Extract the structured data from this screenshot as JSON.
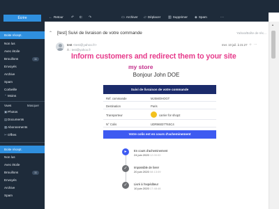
{
  "sidebar": {
    "compose_label": "Écrire",
    "folders_top": [
      {
        "label": "Boite récept.",
        "count": "",
        "active": true
      },
      {
        "label": "Non lus",
        "count": ""
      },
      {
        "label": "Avec étoile",
        "count": ""
      },
      {
        "label": "Brouillons",
        "count": "11"
      },
      {
        "label": "Envoyés",
        "count": ""
      },
      {
        "label": "Archive",
        "count": ""
      },
      {
        "label": "Spam",
        "count": ""
      },
      {
        "label": "Corbeille",
        "count": ""
      },
      {
        "label": "Moins",
        "count": ""
      }
    ],
    "views_label": "Vues",
    "views_action": "Masquer",
    "views": [
      {
        "label": "Photos",
        "icon": "photos-icon"
      },
      {
        "label": "Documents",
        "icon": "documents-icon"
      },
      {
        "label": "Abonnements",
        "icon": "subscriptions-icon"
      },
      {
        "label": "Offres",
        "icon": "offers-icon"
      }
    ],
    "folders_bottom": [
      {
        "label": "Boite récept.",
        "count": "",
        "active": true
      },
      {
        "label": "Non lus",
        "count": ""
      },
      {
        "label": "Avec étoile",
        "count": ""
      },
      {
        "label": "Brouillons",
        "count": "11"
      },
      {
        "label": "Envoyés",
        "count": ""
      },
      {
        "label": "Archive",
        "count": ""
      },
      {
        "label": "Spam",
        "count": ""
      }
    ]
  },
  "toolbar": {
    "back_label": "Retour",
    "archive_label": "Archiver",
    "move_label": "Déplacer",
    "delete_label": "Supprimer",
    "spam_label": "Spam"
  },
  "message": {
    "subject": "[test] Suivi de livraison de votre commande",
    "folder_hint": "Yahoo/Boîte de réc...",
    "from_name": "test",
    "from_email": "<test@yahoo.fr>",
    "to_prefix": "À :",
    "to_email": "test@yahoo.fr",
    "date": "mer. 10 juil. à 21:27"
  },
  "email": {
    "banner": "Inform customers and redirect them to your site",
    "logo": "my store",
    "greeting": "Bonjour John DOE",
    "table_title": "Suivi de livraison de votre commande",
    "rows": [
      {
        "key": "Réf. commande",
        "value": "MJSMOHOGT"
      },
      {
        "key": "Destination",
        "value": "Paris"
      },
      {
        "key": "Transporteur",
        "value": "carrier for shop2"
      },
      {
        "key": "N° Colis",
        "value": "UDR86037T6SC4"
      }
    ],
    "status_text": "Votre colis est en cours d'acheminement",
    "steps": [
      {
        "title": "En cours d'acheminement",
        "date": "24 juin 2020",
        "time": "12:00:00",
        "color": "#3d5af1"
      },
      {
        "title": "Impossible de livrer",
        "date": "20 juin 2020",
        "time": "08:13:09",
        "color": "#6d6f73"
      },
      {
        "title": "Livré à l'expéditeur",
        "date": "10 juin 2020",
        "time": "17:48:48",
        "color": "#6d6f73"
      }
    ]
  },
  "colors": {
    "sidebar_bg": "#1e2b3a",
    "accent": "#2f8fde",
    "banner": "#e6398a",
    "table_head": "#1b2b6b",
    "status_bar": "#3d5af1"
  }
}
